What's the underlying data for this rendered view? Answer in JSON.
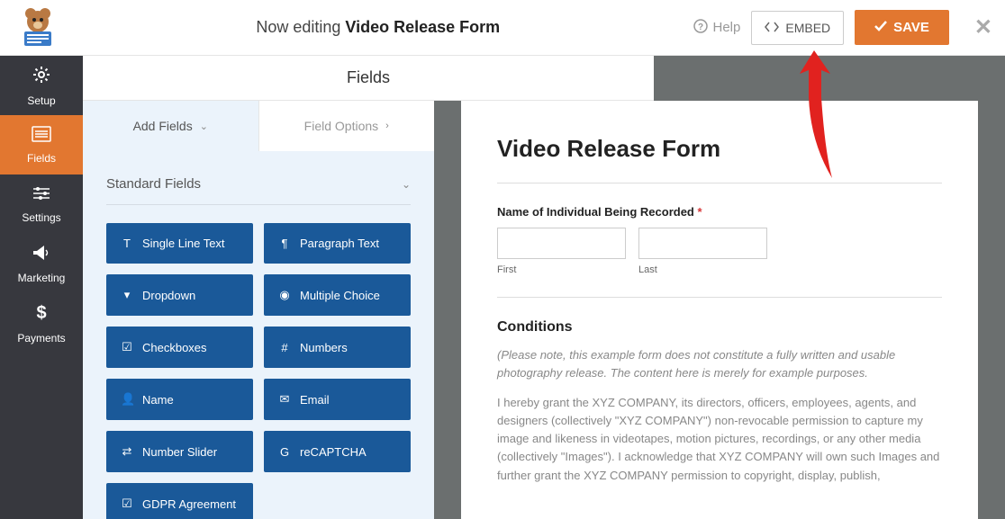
{
  "header": {
    "editing_prefix": "Now editing",
    "editing_title": "Video Release Form",
    "help": "Help",
    "embed": "EMBED",
    "save": "SAVE"
  },
  "leftnav": {
    "items": [
      {
        "label": "Setup"
      },
      {
        "label": "Fields"
      },
      {
        "label": "Settings"
      },
      {
        "label": "Marketing"
      },
      {
        "label": "Payments"
      }
    ]
  },
  "section_title": "Fields",
  "tabs": {
    "add_fields": "Add Fields",
    "field_options": "Field Options"
  },
  "standard_fields_header": "Standard Fields",
  "fields": [
    {
      "label": "Single Line Text"
    },
    {
      "label": "Paragraph Text"
    },
    {
      "label": "Dropdown"
    },
    {
      "label": "Multiple Choice"
    },
    {
      "label": "Checkboxes"
    },
    {
      "label": "Numbers"
    },
    {
      "label": "Name"
    },
    {
      "label": "Email"
    },
    {
      "label": "Number Slider"
    },
    {
      "label": "reCAPTCHA"
    },
    {
      "label": "GDPR Agreement"
    }
  ],
  "form": {
    "title": "Video Release Form",
    "name_field_label": "Name of Individual Being Recorded",
    "first": "First",
    "last": "Last",
    "conditions_title": "Conditions",
    "conditions_note": "(Please note, this example form does not constitute a fully written and usable photography release. The content here is merely for example purposes.",
    "conditions_text": "I hereby grant the XYZ COMPANY, its directors, officers, employees, agents, and designers (collectively \"XYZ COMPANY\") non-revocable permission to capture my image and likeness in videotapes, motion pictures, recordings, or any other media (collectively \"Images\"). I acknowledge that XYZ COMPANY will own such Images and further grant the XYZ COMPANY permission to copyright, display, publish,"
  }
}
